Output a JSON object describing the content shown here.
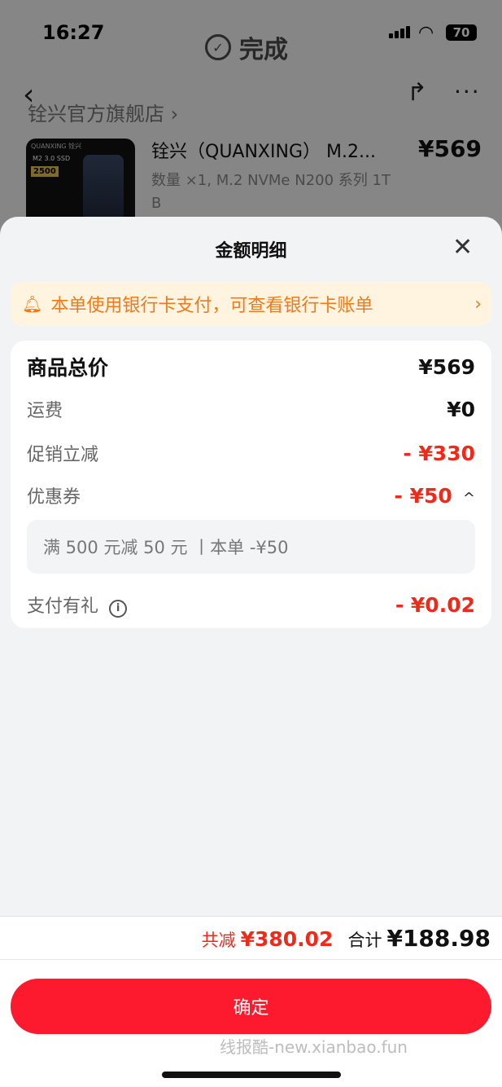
{
  "status_bar": {
    "time": "16:27",
    "battery": "70"
  },
  "header": {
    "done_label": "完成",
    "store_name": "铨兴官方旗舰店 ›"
  },
  "product": {
    "title": "铨兴（QUANXING） M.2...",
    "spec": "数量 ×1, M.2 NVMe N200 系列 1T B",
    "price": "¥569",
    "thumb_brand": "QUANXING 铨兴",
    "thumb_model": "M2 3.0 SSD",
    "thumb_speed": "2500"
  },
  "sheet": {
    "title": "金额明细",
    "notice": "本单使用银行卡支付，可查看银行卡账单",
    "rows": {
      "total": {
        "label": "商品总价",
        "value": "¥569"
      },
      "shipping": {
        "label": "运费",
        "value": "¥0"
      },
      "promo": {
        "label": "促销立减",
        "value": "- ¥330"
      },
      "coupon": {
        "label": "优惠券",
        "value": "- ¥50"
      },
      "coupon_detail": "满 500 元减 50 元  丨本单 -¥50",
      "pay_gift": {
        "label": "支付有礼",
        "value": "- ¥0.02"
      }
    }
  },
  "footer": {
    "saved_label": "共减",
    "saved_value": "¥380.02",
    "total_label": "合计",
    "total_value": "¥188.98",
    "confirm_label": "确定",
    "watermark": "线报酷-new.xianbao.fun"
  },
  "colors": {
    "accent_red": "#fe1a2e",
    "discount_red": "#ee2a1b",
    "notice_orange": "#f07a19",
    "notice_bg": "#fff4e0"
  },
  "icons": [
    "back-icon",
    "share-icon",
    "more-icon",
    "close-icon",
    "bell-icon",
    "chevron-right-icon",
    "chevron-up-icon",
    "info-icon"
  ]
}
